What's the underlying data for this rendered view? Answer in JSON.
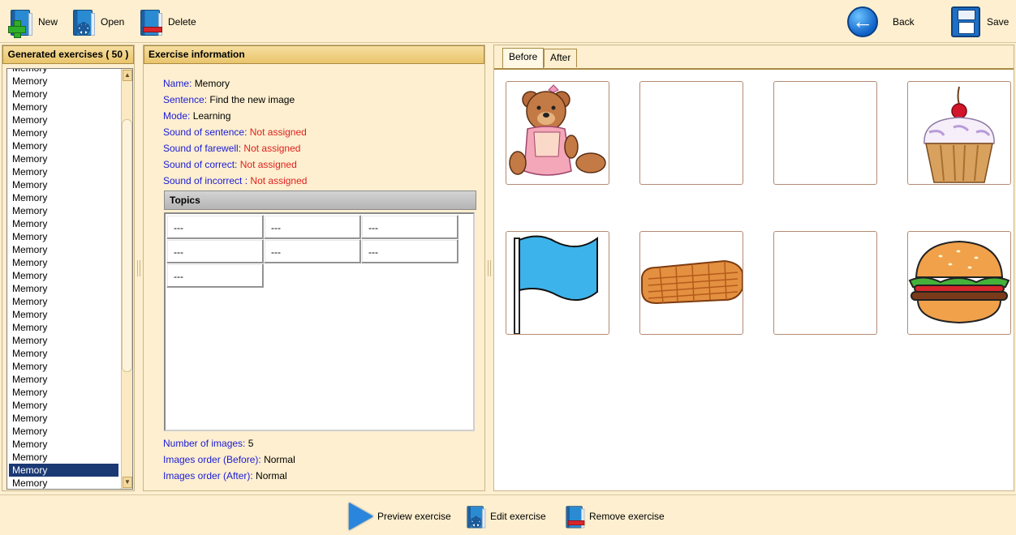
{
  "toolbar": {
    "new_label": "New",
    "open_label": "Open",
    "delete_label": "Delete",
    "back_label": "Back",
    "save_label": "Save"
  },
  "left_panel": {
    "title": "Generated exercises ( 50 )",
    "items": [
      "Memory",
      "Memory",
      "Memory",
      "Memory",
      "Memory",
      "Memory",
      "Memory",
      "Memory",
      "Memory",
      "Memory",
      "Memory",
      "Memory",
      "Memory",
      "Memory",
      "Memory",
      "Memory",
      "Memory",
      "Memory",
      "Memory",
      "Memory",
      "Memory",
      "Memory",
      "Memory",
      "Memory",
      "Memory",
      "Memory",
      "Memory",
      "Memory",
      "Memory",
      "Memory",
      "Memory",
      "Memory",
      "Memory"
    ],
    "selected_index": 31
  },
  "info": {
    "title": "Exercise information",
    "name_key": "Name:",
    "name_val": "Memory",
    "sentence_key": "Sentence:",
    "sentence_val": "Find the new image",
    "mode_key": "Mode:",
    "mode_val": "Learning",
    "sound_sentence_key": "Sound of sentence:",
    "sound_sentence_val": "Not assigned",
    "sound_farewell_key": "Sound of farewell:",
    "sound_farewell_val": "Not assigned",
    "sound_correct_key": "Sound of correct:",
    "sound_correct_val": "Not assigned",
    "sound_incorrect_key": "Sound of incorrect :",
    "sound_incorrect_val": "Not assigned",
    "topics_title": "Topics",
    "topics": [
      "---",
      "---",
      "---",
      "---",
      "---",
      "---",
      "---"
    ],
    "num_images_key": "Number of images:",
    "num_images_val": "5",
    "order_before_key": "Images order (Before):",
    "order_before_val": "Normal",
    "order_after_key": "Images order (After):",
    "order_after_val": "Normal"
  },
  "tabs": {
    "before": "Before",
    "after": "After",
    "active": "Before"
  },
  "images": [
    "teddy-bear",
    "empty",
    "empty",
    "cupcake",
    "flag",
    "blanket",
    "empty",
    "hamburger"
  ],
  "bottom": {
    "preview_label": "Preview exercise",
    "edit_label": "Edit exercise",
    "remove_label": "Remove exercise"
  },
  "colors": {
    "accent": "#e9c46a",
    "key_text": "#1b1bd6",
    "unassigned": "#e01f1f",
    "selection": "#1b3a74"
  }
}
